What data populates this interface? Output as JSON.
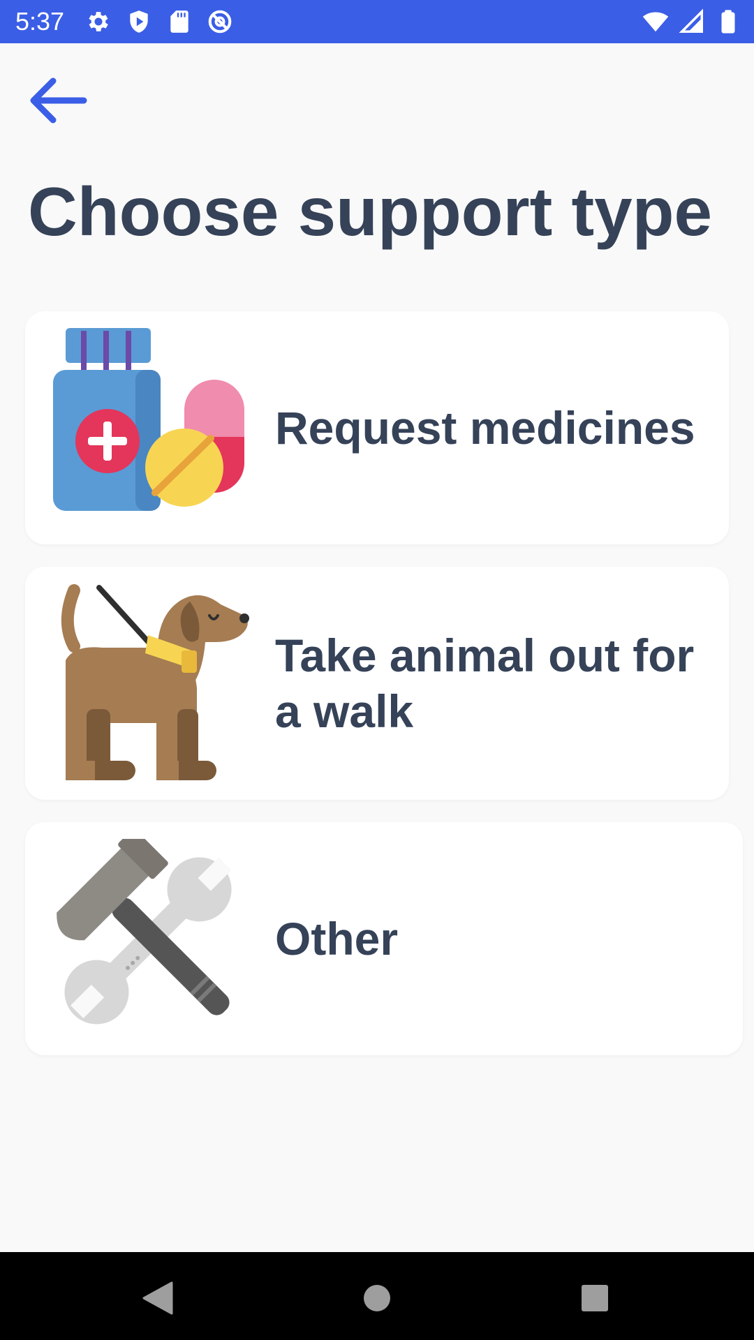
{
  "status_bar": {
    "time": "5:37",
    "left_icons": [
      "settings-gear-icon",
      "shield-play-icon",
      "sd-card-icon",
      "at-sign-icon"
    ],
    "right_icons": [
      "wifi-icon",
      "cell-signal-icon",
      "battery-icon"
    ]
  },
  "header": {
    "back_icon": "arrow-left-icon",
    "title": "Choose support type"
  },
  "options": [
    {
      "label": "Request medicines",
      "icon": "medicines-icon"
    },
    {
      "label": "Take animal out for a walk",
      "icon": "dog-walk-icon"
    },
    {
      "label": "Other",
      "icon": "tools-icon"
    }
  ],
  "nav_bar": {
    "buttons": [
      "nav-back-icon",
      "nav-home-icon",
      "nav-recents-icon"
    ]
  },
  "colors": {
    "status_bar": "#3b5ee6",
    "accent": "#3b5ee6",
    "text": "#354258",
    "background": "#f9f9f9",
    "card": "#ffffff"
  }
}
